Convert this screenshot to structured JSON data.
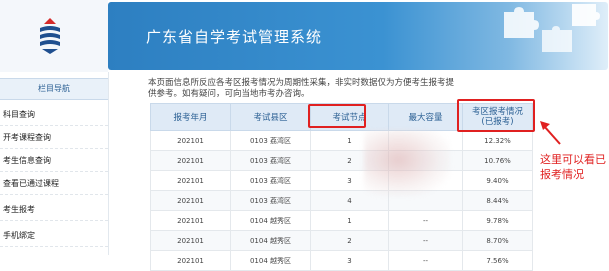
{
  "header": {
    "title": "广东省自学考试管理系统"
  },
  "sidebar": {
    "heading": "栏目导航",
    "items": [
      {
        "label": "科目查询"
      },
      {
        "label": "开考课程查询"
      },
      {
        "label": "考生信息查询"
      },
      {
        "label": "查看已通过课程"
      },
      {
        "label": "考生报考"
      },
      {
        "label": "手机绑定"
      }
    ]
  },
  "notice": "本页面信息所反应各考区报考情况为周期性采集，非实时数据仅为方便考生报考提供参考。如有疑问，可向当地市考办咨询。",
  "table": {
    "headers": [
      "报考年月",
      "考试县区",
      "考试节点",
      "最大容量",
      "考区报考情况\n(已报考)"
    ],
    "rows": [
      [
        "202101",
        "0103 荔湾区",
        "1",
        "",
        "12.32%"
      ],
      [
        "202101",
        "0103 荔湾区",
        "2",
        "",
        "10.76%"
      ],
      [
        "202101",
        "0103 荔湾区",
        "3",
        "",
        "9.40%"
      ],
      [
        "202101",
        "0103 荔湾区",
        "4",
        "",
        "8.44%"
      ],
      [
        "202101",
        "0104 越秀区",
        "1",
        "--",
        "9.78%"
      ],
      [
        "202101",
        "0104 越秀区",
        "2",
        "--",
        "8.70%"
      ],
      [
        "202101",
        "0104 越秀区",
        "3",
        "--",
        "7.56%"
      ]
    ]
  },
  "annotation": "这里可以看已报考情况",
  "colors": {
    "banner": "#2d7fc1",
    "highlight": "#e02020",
    "header_text": "#2a5f93"
  }
}
